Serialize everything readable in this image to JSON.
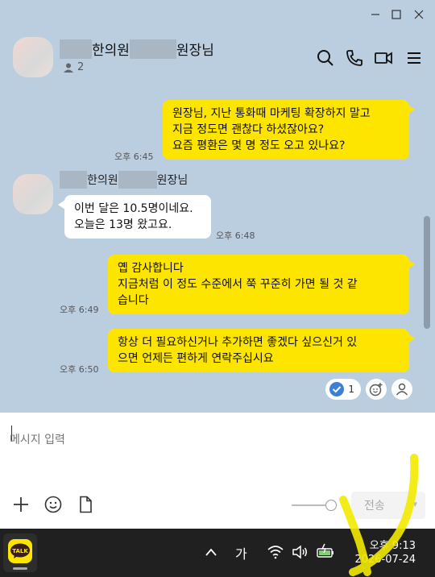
{
  "window": {
    "room": {
      "name_middle": "한의원",
      "name_suffix": "원장님",
      "member_count": "2"
    }
  },
  "messages": [
    {
      "from": "me",
      "lines": [
        "원장님, 지난 통화때 마케팅 확장하지 말고",
        "지금 정도면 괜찮다 하셨잖아요?",
        "요즘 평환은 몇 명 정도 오고 있나요?"
      ],
      "time": "오후 6:45"
    },
    {
      "from": "them",
      "sender_middle": "한의원",
      "sender_suffix": "원장님",
      "lines": [
        "이번 달은 10.5명이네요.",
        "오늘은 13명 왔고요."
      ],
      "time": "오후 6:48"
    },
    {
      "from": "me",
      "lines": [
        "옙 감사합니다",
        "지금처럼 이 정도 수준에서 쭉 꾸준히 가면 될 것 같",
        "습니다"
      ],
      "time": "오후 6:49"
    },
    {
      "from": "me",
      "lines": [
        "항상 더 필요하신거나 추가하면 좋겠다 싶으신거 있",
        "으면 언제든 편하게 연락주십시요"
      ],
      "time": "오후 6:50"
    }
  ],
  "reactions": {
    "check_count": "1"
  },
  "composer": {
    "placeholder": "메시지 입력",
    "send_label": "전송"
  },
  "taskbar": {
    "ime_label": "가",
    "app_label": "TALK",
    "clock_time": "오후 9:13",
    "clock_date": "2026-07-24"
  },
  "colors": {
    "chat_bg": "#bacee0",
    "my_bubble": "#fee500",
    "their_bubble": "#ffffff",
    "taskbar": "#202020",
    "check_blue": "#3d7fd6"
  }
}
